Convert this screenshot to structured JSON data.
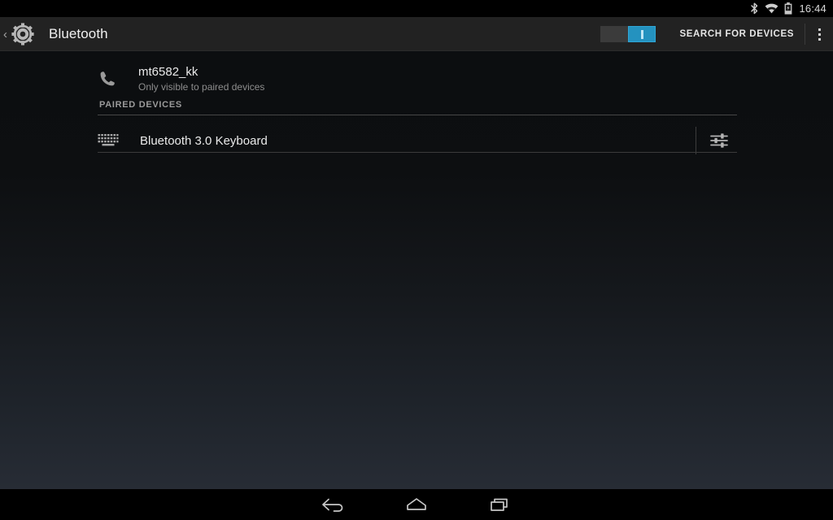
{
  "status_bar": {
    "clock": "16:44",
    "icons": [
      {
        "name": "bluetooth-status-icon",
        "label": "bluetooth"
      },
      {
        "name": "wifi-status-icon",
        "label": "wifi"
      },
      {
        "name": "battery-status-icon",
        "label": "battery"
      }
    ]
  },
  "action_bar": {
    "back_chevron": "‹",
    "app_icon": "settings-gear-icon",
    "title": "Bluetooth",
    "switch": {
      "name": "bluetooth-toggle",
      "state": "on",
      "on_color": "#2492bf",
      "off_color": "#3b3b3b"
    },
    "search_label": "SEARCH FOR DEVICES",
    "overflow_label": "overflow-menu"
  },
  "content": {
    "local_device": {
      "icon": "phone-icon",
      "name": "mt6582_kk",
      "subtitle": "Only visible to paired devices"
    },
    "paired_section": {
      "header": "PAIRED DEVICES",
      "devices": [
        {
          "icon": "keyboard-icon",
          "name": "Bluetooth 3.0 Keyboard",
          "settings_icon": "sliders-settings-icon"
        }
      ]
    }
  },
  "nav_bar": {
    "back": "back-nav-icon",
    "home": "home-nav-icon",
    "recents": "recents-nav-icon"
  },
  "theme": {
    "accent": "#33b5e5",
    "action_bar_bg": "#222222",
    "text_primary": "#eaeaea",
    "text_secondary": "#8d8d8d"
  }
}
